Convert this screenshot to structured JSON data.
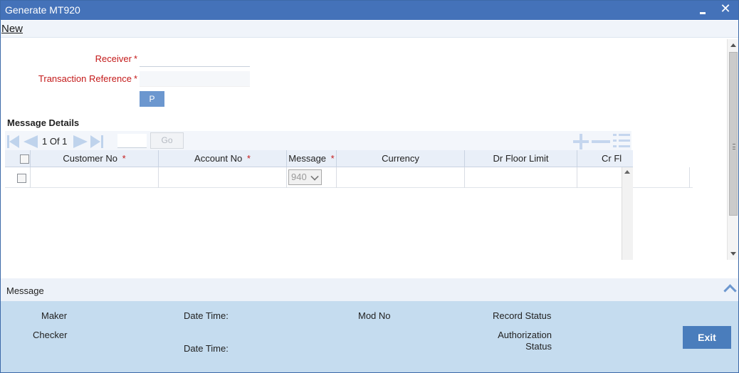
{
  "window": {
    "title": "Generate MT920"
  },
  "menu": {
    "new_label": "New"
  },
  "form": {
    "receiver_label": "Receiver",
    "receiver_value": "",
    "transaction_reference_label": "Transaction Reference",
    "transaction_reference_value": "",
    "required_mark": "*",
    "p_button_label": "P"
  },
  "message_details": {
    "section_title": "Message Details",
    "pager": {
      "label": "1 Of 1",
      "page_input": "",
      "go_label": "Go"
    },
    "columns": [
      {
        "label": "Customer No",
        "required": "*"
      },
      {
        "label": "Account No",
        "required": "*"
      },
      {
        "label": "Message",
        "required": "*"
      },
      {
        "label": "Currency",
        "required": ""
      },
      {
        "label": "Dr Floor Limit",
        "required": ""
      },
      {
        "label": "Cr Fl",
        "required": ""
      }
    ],
    "rows": [
      {
        "customer_no": "",
        "account_no": "",
        "message": "940",
        "currency": "",
        "dr_floor_limit": "",
        "cr_floor_limit": ""
      }
    ]
  },
  "message_bar": {
    "label": "Message"
  },
  "audit": {
    "maker_label": "Maker",
    "checker_label": "Checker",
    "date_time_label_1": "Date Time:",
    "date_time_label_2": "Date Time:",
    "mod_no_label": "Mod No",
    "record_status_label": "Record Status",
    "authorization_status_label": "Authorization\nStatus",
    "exit_label": "Exit"
  },
  "colors": {
    "title_bar": "#4472b9",
    "accent": "#6c97cf",
    "required": "#c41a1a",
    "audit_bg": "#c5dcef",
    "exit_button": "#4a7dbc"
  },
  "icons": [
    "minimize-icon",
    "close-icon",
    "first-page-icon",
    "prev-page-icon",
    "next-page-icon",
    "last-page-icon",
    "add-row-icon",
    "delete-row-icon",
    "single-view-icon",
    "chevron-down-icon",
    "collapse-up-icon"
  ]
}
